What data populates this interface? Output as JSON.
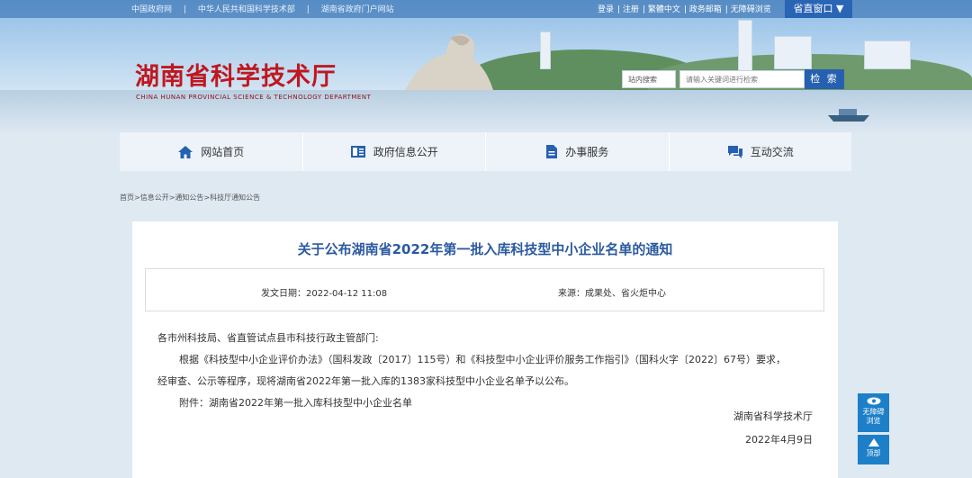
{
  "top_links_left": [
    "中国政府网",
    "中华人民共和国科学技术部",
    "湖南省政府门户网站"
  ],
  "top_links_right": [
    "登录",
    "注册",
    "繁體中文",
    "政务邮箱",
    "无障碍浏览"
  ],
  "region_button": "省直窗口",
  "site": {
    "title": "湖南省科学技术厅",
    "subtitle": "CHINA HUNAN PROVINCIAL SCIENCE & TECHNOLOGY DEPARTMENT"
  },
  "search": {
    "scope": "站内搜索",
    "placeholder": "请输入关键词进行检索",
    "button": "检 索"
  },
  "nav": [
    {
      "label": "网站首页",
      "icon": "home-icon"
    },
    {
      "label": "政府信息公开",
      "icon": "document-icon"
    },
    {
      "label": "办事服务",
      "icon": "file-icon"
    },
    {
      "label": "互动交流",
      "icon": "chat-icon"
    }
  ],
  "breadcrumb": "首页>信息公开>通知公告>科技厅通知公告",
  "article": {
    "title": "关于公布湖南省2022年第一批入库科技型中小企业名单的通知",
    "date_label": "发文日期：",
    "date": "2022-04-12 11:08",
    "source_label": "来源：",
    "source": "成果处、省火炬中心",
    "greeting": "各市州科技局、省直管试点县市科技行政主管部门:",
    "para1": "根据《科技型中小企业评价办法》（国科发政〔2017〕115号）和《科技型中小企业评价服务工作指引》（国科火字〔2022〕67号）要求，",
    "para2": "经审查、公示等程序，现将湖南省2022年第一批入库的1383家科技型中小企业名单予以公布。",
    "attachment": "附件：湖南省2022年第一批入库科技型中小企业名单",
    "signature": "湖南省科学技术厅",
    "sign_date": "2022年4月9日"
  },
  "side": {
    "accessible_line1": "无障碍",
    "accessible_line2": "浏览",
    "top": "顶部"
  },
  "colors": {
    "title_red": "#c0171f",
    "link_blue": "#2b5aa0",
    "button_blue": "#2660b0",
    "side_blue": "#1d7fc8"
  }
}
